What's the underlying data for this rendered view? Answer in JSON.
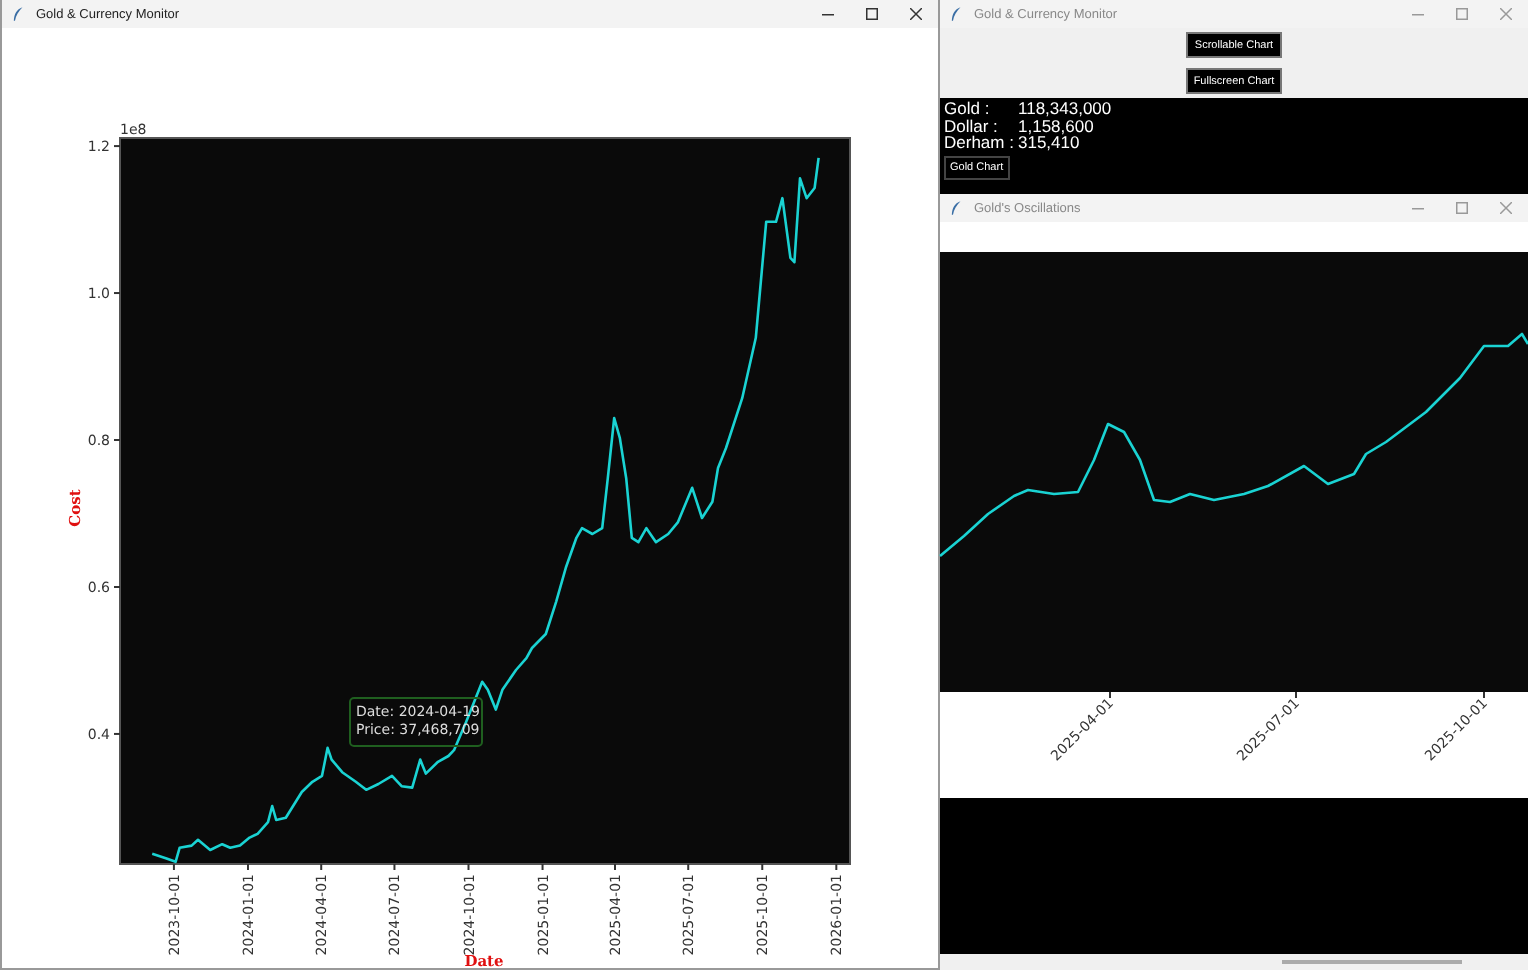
{
  "main_window": {
    "title": "Gold & Currency Monitor",
    "chart_data": {
      "type": "line",
      "xlabel": "Date",
      "ylabel": "Cost",
      "xlim": [
        "2023-07-26",
        "2026-01-18"
      ],
      "ylim": [
        0.223,
        1.211
      ],
      "xticks": [
        "2023-10-01",
        "2024-01-01",
        "2024-04-01",
        "2024-07-01",
        "2024-10-01",
        "2025-01-01",
        "2025-04-01",
        "2025-07-01",
        "2025-10-01",
        "2026-01-01"
      ],
      "yticks": [
        {
          "value": 0.4,
          "label": "0.4"
        },
        {
          "value": 0.6,
          "label": "0.6"
        },
        {
          "value": 0.8,
          "label": "0.8"
        },
        {
          "value": 1.0,
          "label": "1.0"
        },
        {
          "value": 1.2,
          "label": "1.2"
        }
      ],
      "x": [
        "2023-09-04",
        "2023-09-21",
        "2023-10-03",
        "2023-10-08",
        "2023-10-23",
        "2023-10-31",
        "2023-11-15",
        "2023-11-30",
        "2023-12-10",
        "2023-12-22",
        "2024-01-03",
        "2024-01-13",
        "2024-01-26",
        "2024-01-31",
        "2024-02-05",
        "2024-02-17",
        "2024-03-08",
        "2024-03-21",
        "2024-04-02",
        "2024-04-09",
        "2024-04-14",
        "2024-04-27",
        "2024-05-14",
        "2024-05-27",
        "2024-06-11",
        "2024-06-28",
        "2024-07-10",
        "2024-07-23",
        "2024-08-02",
        "2024-08-09",
        "2024-08-24",
        "2024-09-06",
        "2024-09-13",
        "2024-09-28",
        "2024-10-18",
        "2024-10-25",
        "2024-11-04",
        "2024-11-12",
        "2024-11-29",
        "2024-12-12",
        "2024-12-19",
        "2025-01-05",
        "2025-01-18",
        "2025-01-30",
        "2025-02-12",
        "2025-02-19",
        "2025-03-04",
        "2025-03-16",
        "2025-03-23",
        "2025-03-31",
        "2025-04-07",
        "2025-04-15",
        "2025-04-22",
        "2025-04-30",
        "2025-05-10",
        "2025-05-22",
        "2025-06-06",
        "2025-06-18",
        "2025-07-06",
        "2025-07-18",
        "2025-07-31",
        "2025-08-07",
        "2025-08-17",
        "2025-09-06",
        "2025-09-23",
        "2025-10-06",
        "2025-10-18",
        "2025-10-26",
        "2025-11-05",
        "2025-11-10",
        "2025-11-17",
        "2025-11-25",
        "2025-12-05",
        "2025-12-10"
      ],
      "series": [
        {
          "color": "#1ad3d3",
          "values": [
            0.237,
            0.231,
            0.226,
            0.245,
            0.248,
            0.256,
            0.242,
            0.25,
            0.245,
            0.248,
            0.259,
            0.264,
            0.28,
            0.302,
            0.283,
            0.286,
            0.321,
            0.335,
            0.343,
            0.381,
            0.365,
            0.348,
            0.335,
            0.324,
            0.332,
            0.343,
            0.329,
            0.327,
            0.365,
            0.346,
            0.362,
            0.37,
            0.378,
            0.416,
            0.471,
            0.46,
            0.433,
            0.46,
            0.487,
            0.503,
            0.517,
            0.536,
            0.58,
            0.626,
            0.667,
            0.68,
            0.672,
            0.68,
            0.748,
            0.83,
            0.803,
            0.748,
            0.667,
            0.661,
            0.68,
            0.661,
            0.672,
            0.688,
            0.735,
            0.694,
            0.716,
            0.762,
            0.789,
            0.857,
            0.939,
            1.097,
            1.097,
            1.129,
            1.048,
            1.042,
            1.156,
            1.129,
            1.143,
            1.184
          ]
        }
      ],
      "annotations": [
        {
          "text": [
            "Date: 2024-04-19",
            "Price: 37,468,709"
          ]
        }
      ]
    },
    "y_axis_offset": "1e8"
  },
  "monitor_window": {
    "title": "Gold & Currency Monitor",
    "buttons": [
      {
        "label": "Scrollable Chart"
      },
      {
        "label": "Fullscreen Chart"
      }
    ],
    "rates": [
      {
        "name": "Gold :",
        "value": "118,343,000"
      },
      {
        "name": "Dollar :",
        "value": "1,158,600"
      },
      {
        "name": "Derham :",
        "value": "315,410"
      }
    ],
    "chart_button": "Gold Chart"
  },
  "oscillations_window": {
    "title": "Gold's Oscillations",
    "x_tick_labels": [
      "2025-04-01",
      "2025-07-01",
      "2025-10-01"
    ]
  }
}
